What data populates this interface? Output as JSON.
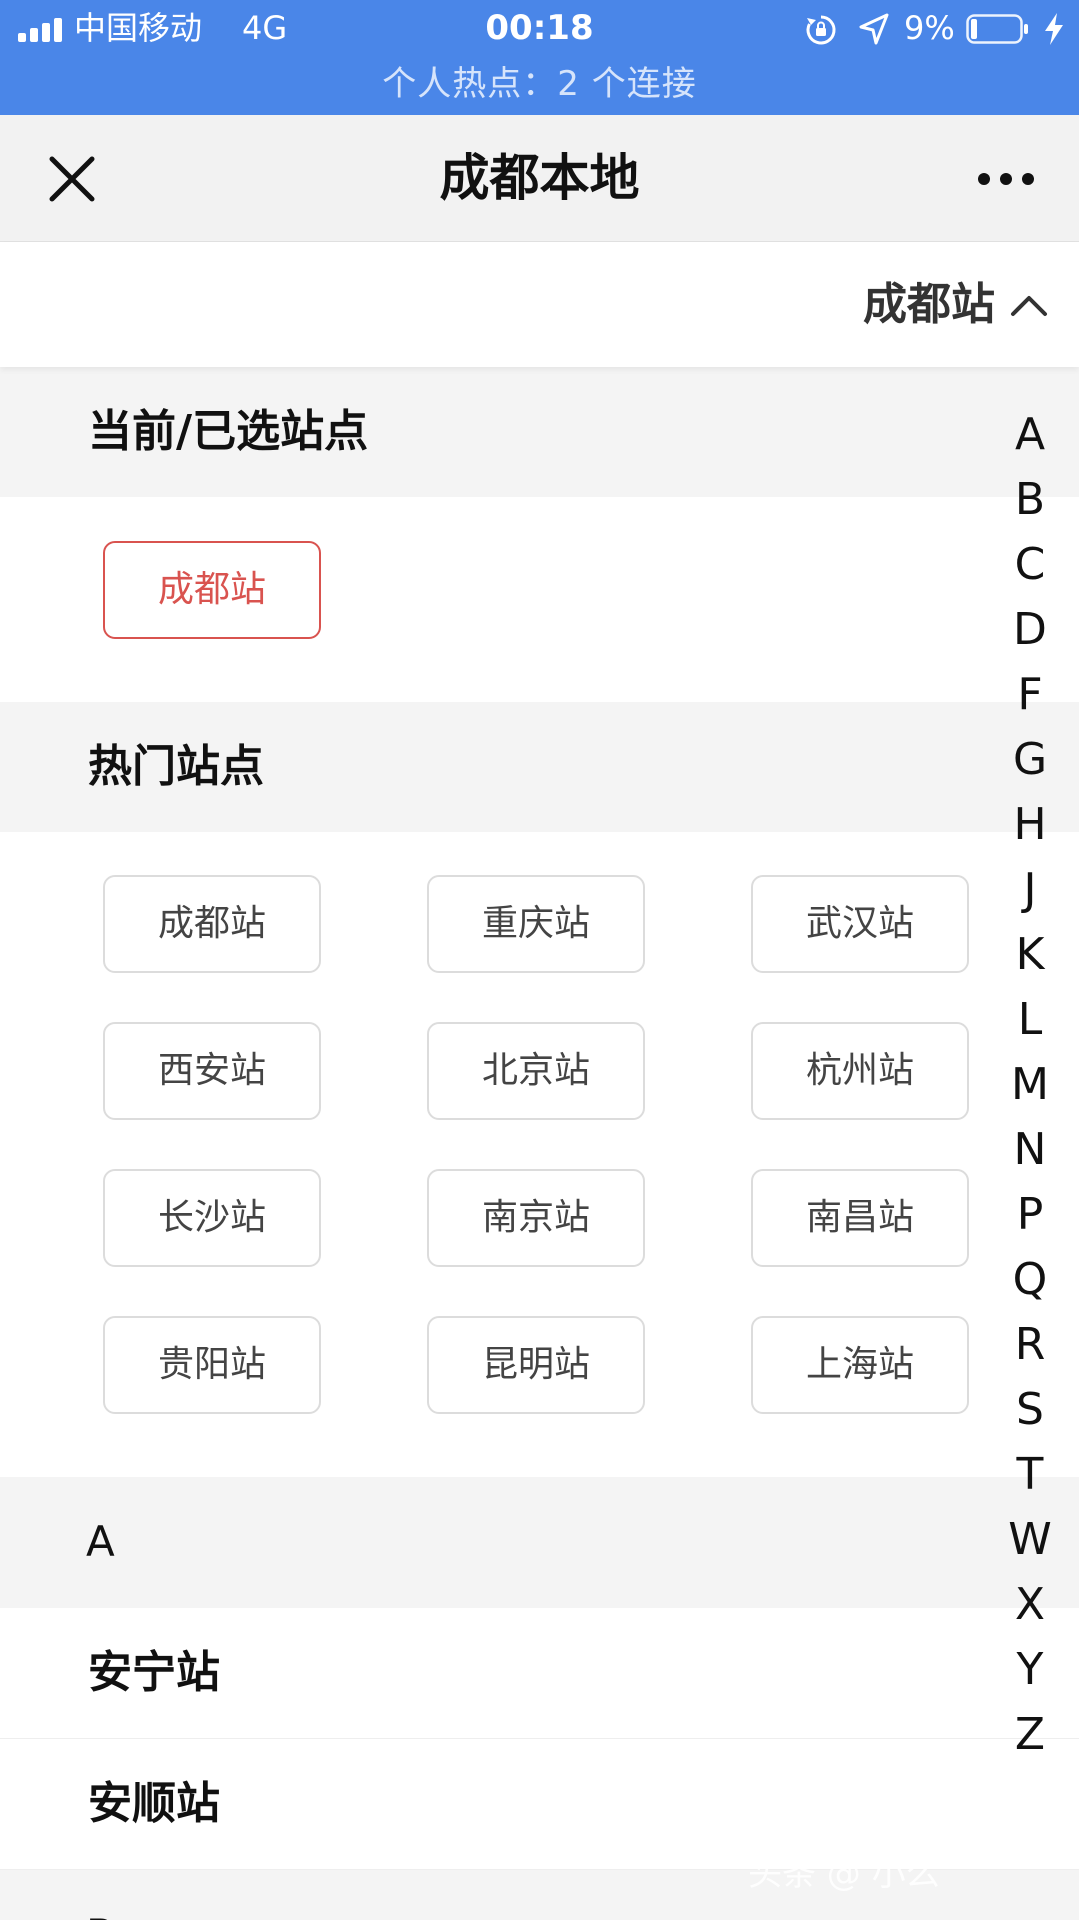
{
  "status_bar": {
    "carrier": "中国移动",
    "network": "4G",
    "time": "00:18",
    "battery": "9%",
    "hotspot": "个人热点：2 个连接",
    "icons": [
      "signal-bars-icon",
      "rotation-lock-icon",
      "location-arrow-icon",
      "battery-icon",
      "charging-bolt-icon"
    ]
  },
  "nav": {
    "title": "成都本地",
    "close_icon": "close-icon",
    "more_icon": "more-dots-icon"
  },
  "station_selector": {
    "label": "成都站",
    "icon": "chevron-up-icon"
  },
  "current_section": {
    "title": "当前/已选站点",
    "selected": "成都站",
    "accent_color": "#d9534f"
  },
  "hot_section": {
    "title": "热门站点",
    "stations": [
      "成都站",
      "重庆站",
      "武汉站",
      "西安站",
      "北京站",
      "杭州站",
      "长沙站",
      "南京站",
      "南昌站",
      "贵阳站",
      "昆明站",
      "上海站"
    ]
  },
  "station_list": {
    "groups": [
      {
        "letter": "A",
        "stations": [
          "安宁站",
          "安顺站"
        ]
      },
      {
        "letter": "B",
        "stations": []
      }
    ]
  },
  "alpha_index": [
    "A",
    "B",
    "C",
    "D",
    "F",
    "G",
    "H",
    "J",
    "K",
    "L",
    "M",
    "N",
    "P",
    "Q",
    "R",
    "S",
    "T",
    "W",
    "X",
    "Y",
    "Z"
  ],
  "watermark": "头条 @ 小么"
}
